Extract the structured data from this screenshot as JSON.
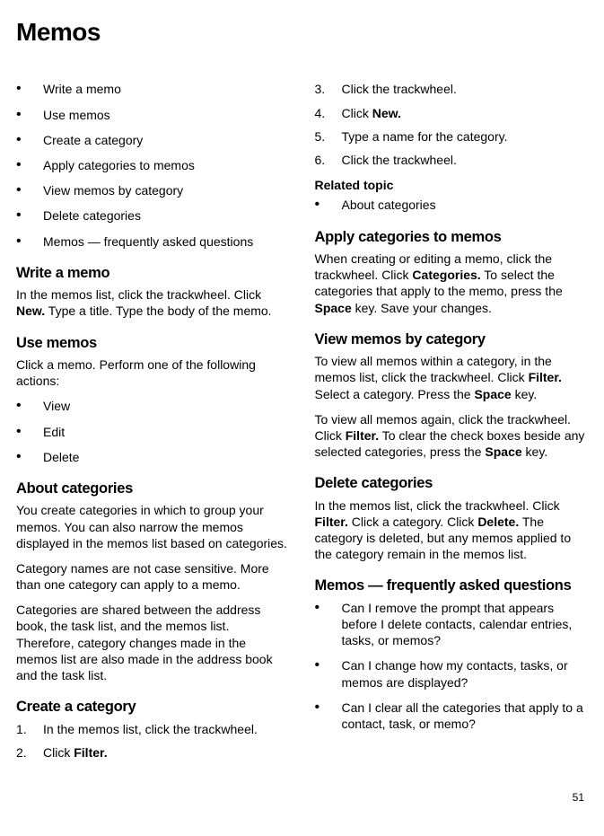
{
  "page_number": "51",
  "title": "Memos",
  "left": {
    "toc": [
      "Write a memo",
      "Use memos",
      "Create a category",
      "Apply categories to memos",
      "View memos by category",
      "Delete categories",
      "Memos — frequently asked questions"
    ],
    "write_heading": "Write a memo",
    "write_text_a": "In the memos list, click the trackwheel. Click ",
    "write_new": "New.",
    "write_text_b": " Type a title. Type the body of the memo.",
    "use_heading": "Use memos",
    "use_text": "Click a memo. Perform one of the following actions:",
    "use_items": [
      "View",
      "Edit",
      "Delete"
    ],
    "about_heading": "About categories",
    "about_p1": "You create categories in which to group your memos. You can also narrow the memos displayed in the memos list based on categories.",
    "about_p2": "Category names are not case sensitive. More than one category can apply to a memo.",
    "about_p3": "Categories are shared between the address book, the task list, and the memos list. Therefore, category changes made in the memos list are also made in the address book and the task list.",
    "create_heading": "Create a category",
    "create_step1": "In the memos list, click the trackwheel.",
    "create_step2_a": "Click ",
    "create_step2_b": "Filter."
  },
  "right": {
    "step3": "Click the trackwheel.",
    "step4_a": "Click ",
    "step4_b": "New.",
    "step5": "Type a name for the category.",
    "step6": "Click the trackwheel.",
    "related_heading": "Related topic",
    "related_item": "About categories",
    "apply_heading": "Apply categories to memos",
    "apply_a": "When creating or editing a memo, click the trackwheel. Click ",
    "apply_categories": "Categories.",
    "apply_b": " To select the categories that apply to the memo, press the ",
    "apply_space": "Space",
    "apply_c": " key. Save your changes.",
    "view_heading": "View memos by category",
    "view_p1_a": "To view all memos within a category, in the memos list, click the trackwheel. Click ",
    "view_filter": "Filter.",
    "view_p1_b": " Select a category. Press the ",
    "view_space": "Space",
    "view_p1_c": " key.",
    "view_p2_a": "To view all memos again, click the trackwheel. Click ",
    "view_filter2": "Filter.",
    "view_p2_b": " To clear the check boxes beside any selected categories, press the ",
    "view_space2": "Space",
    "view_p2_c": " key.",
    "delete_heading": "Delete categories",
    "delete_a": "In the memos list, click the trackwheel. Click ",
    "delete_filter": "Filter.",
    "delete_b": " Click a category. Click ",
    "delete_delete": "Delete.",
    "delete_c": " The category is deleted, but any memos applied to the category remain in the memos list.",
    "faq_heading": "Memos — frequently asked questions",
    "faq_items": [
      "Can I remove the prompt that appears before I delete contacts, calendar entries, tasks, or memos?",
      "Can I change how my contacts, tasks, or memos are displayed?",
      "Can I clear all the categories that apply to a contact, task, or memo?"
    ]
  }
}
